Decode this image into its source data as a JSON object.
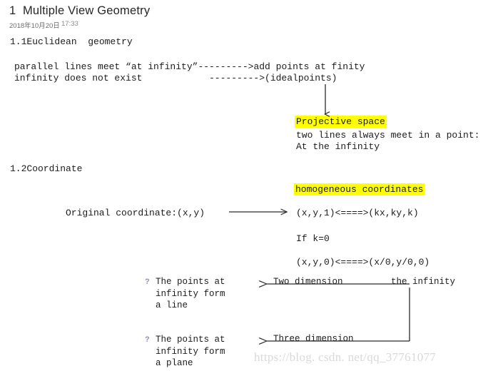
{
  "document": {
    "title": "1  Multiple View Geometry",
    "date": "2018年10月20日",
    "time": "17:33"
  },
  "sections": {
    "euclidean": {
      "heading": "1.1Euclidean  geometry",
      "line1": "parallel lines meet “at infinity”--------->add points at finity",
      "line2": "infinity does not exist",
      "line2_right": "--------->(idealpoints)"
    },
    "projective": {
      "title": "Projective space",
      "line1": "two lines always meet in a point:",
      "line2": "At the infinity"
    },
    "coordinate": {
      "heading": "1.2Coordinate",
      "homogeneous_title": "homogeneous coordinates",
      "original_label": "Original coordinate:(x,y)",
      "equation1": "(x,y,1)<====>(kx,ky,k)",
      "equation2": "If k=0",
      "equation3": "(x,y,0)<====>(x/0,y/0,0)"
    }
  },
  "bullets": [
    {
      "marker": "?",
      "text": "The points at\ninfinity form\na line",
      "arrow_label": "Two dimension"
    },
    {
      "marker": "?",
      "text": "The points at\ninfinity form\na plane",
      "arrow_label": "Three dimension"
    }
  ],
  "labels": {
    "the_infinity": "the infinity"
  },
  "watermark": "https://blog. csdn. net/qq_37761077",
  "colors": {
    "highlight": "#ffff00",
    "bullet_marker": "#9b8fb5",
    "text": "#1c1c1c",
    "watermark": "#d9d9d9",
    "connector": "#2b2b2b"
  }
}
